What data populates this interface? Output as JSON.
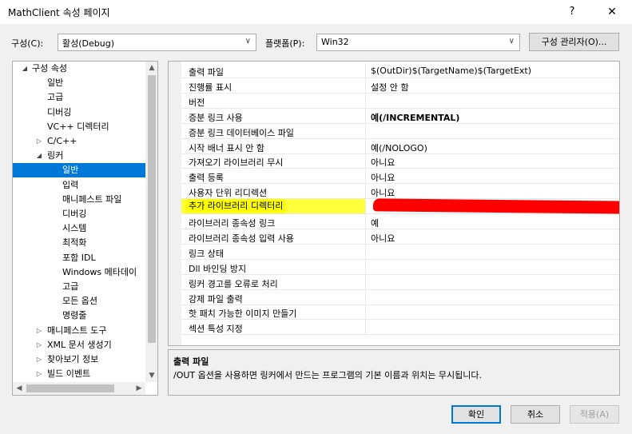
{
  "window": {
    "title": "MathClient 속성 페이지",
    "help": "?",
    "close": "✕"
  },
  "config": {
    "config_label": "구성(C):",
    "config_value": "활성(Debug)",
    "platform_label": "플랫폼(P):",
    "platform_value": "Win32",
    "manager_button": "구성 관리자(O)..."
  },
  "tree": {
    "items": [
      {
        "label": "구성 속성",
        "expander": "◢"
      },
      {
        "label": "일반"
      },
      {
        "label": "고급"
      },
      {
        "label": "디버깅"
      },
      {
        "label": "VC++ 디렉터리"
      },
      {
        "label": "C/C++",
        "expander": "▷"
      },
      {
        "label": "링커",
        "expander": "◢"
      },
      {
        "label": "일반"
      },
      {
        "label": "입력"
      },
      {
        "label": "매니페스트 파일"
      },
      {
        "label": "디버깅"
      },
      {
        "label": "시스템"
      },
      {
        "label": "최적화"
      },
      {
        "label": "포함 IDL"
      },
      {
        "label": "Windows 메타데이"
      },
      {
        "label": "고급"
      },
      {
        "label": "모든 옵션"
      },
      {
        "label": "명령줄"
      },
      {
        "label": "매니페스트 도구",
        "expander": "▷"
      },
      {
        "label": "XML 문서 생성기",
        "expander": "▷"
      },
      {
        "label": "찾아보기 정보",
        "expander": "▷"
      },
      {
        "label": "빌드 이벤트",
        "expander": "▷"
      }
    ],
    "scroll_up": "▲",
    "scroll_down": "▼",
    "scroll_left": "◀",
    "scroll_right": "▶"
  },
  "properties": [
    {
      "name": "출력 파일",
      "value": "$(OutDir)$(TargetName)$(TargetExt)"
    },
    {
      "name": "진행률 표시",
      "value": "설정 안 함"
    },
    {
      "name": "버전",
      "value": ""
    },
    {
      "name": "증분 링크 사용",
      "value": "예(/INCREMENTAL)"
    },
    {
      "name": "증분 링크 데이터베이스 파일",
      "value": ""
    },
    {
      "name": "시작 배너 표시 안 함",
      "value": "예(/NOLOGO)"
    },
    {
      "name": "가져오기 라이브러리 무시",
      "value": "아니요"
    },
    {
      "name": "출력 등록",
      "value": "아니요"
    },
    {
      "name": "사용자 단위 리디렉션",
      "value": "아니요"
    },
    {
      "name": "추가 라이브러리 디렉터리",
      "value": ""
    },
    {
      "name": "라이브러리 종속성 링크",
      "value": "예"
    },
    {
      "name": "라이브러리 종속성 입력 사용",
      "value": "아니요"
    },
    {
      "name": "링크 상태",
      "value": ""
    },
    {
      "name": "Dll 바인딩 방지",
      "value": ""
    },
    {
      "name": "링커 경고를 오류로 처리",
      "value": ""
    },
    {
      "name": "강제 파일 출력",
      "value": ""
    },
    {
      "name": "핫 패치 가능한 이미지 만들기",
      "value": ""
    },
    {
      "name": "섹션 특성 지정",
      "value": ""
    }
  ],
  "description": {
    "title": "출력 파일",
    "text": "/OUT 옵션을 사용하면 링커에서 만드는 프로그램의 기본 이름과 위치는 무시됩니다."
  },
  "buttons": {
    "ok": "확인",
    "cancel": "취소",
    "apply": "적용(A)"
  }
}
